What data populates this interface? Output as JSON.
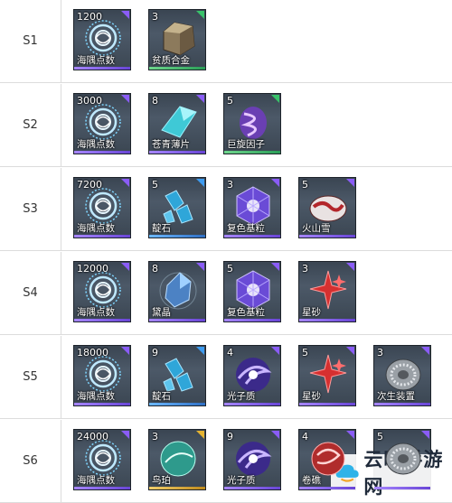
{
  "rows": [
    {
      "tier": "S1",
      "items": [
        {
          "count": "1200",
          "name": "海隅点数",
          "icon": "token-icon",
          "rarity": "purple"
        },
        {
          "count": "3",
          "name": "贫质合金",
          "icon": "alloy-icon",
          "rarity": "green"
        }
      ]
    },
    {
      "tier": "S2",
      "items": [
        {
          "count": "3000",
          "name": "海隅点数",
          "icon": "token-icon",
          "rarity": "purple"
        },
        {
          "count": "8",
          "name": "苍青薄片",
          "icon": "cyan-shard-icon",
          "rarity": "purple"
        },
        {
          "count": "5",
          "name": "巨旋因子",
          "icon": "spiral-factor-icon",
          "rarity": "green"
        }
      ]
    },
    {
      "tier": "S3",
      "items": [
        {
          "count": "7200",
          "name": "海隅点数",
          "icon": "token-icon",
          "rarity": "purple"
        },
        {
          "count": "5",
          "name": "靛石",
          "icon": "indigo-stone-icon",
          "rarity": "blue"
        },
        {
          "count": "3",
          "name": "复色基粒",
          "icon": "multicolor-granule-icon",
          "rarity": "purple"
        },
        {
          "count": "5",
          "name": "火山雪",
          "icon": "volcanic-snow-icon",
          "rarity": "purple"
        }
      ]
    },
    {
      "tier": "S4",
      "items": [
        {
          "count": "12000",
          "name": "海隅点数",
          "icon": "token-icon",
          "rarity": "purple"
        },
        {
          "count": "8",
          "name": "黛晶",
          "icon": "dark-crystal-icon",
          "rarity": "purple"
        },
        {
          "count": "5",
          "name": "复色基粒",
          "icon": "multicolor-granule-icon",
          "rarity": "purple"
        },
        {
          "count": "3",
          "name": "星砂",
          "icon": "star-sand-icon",
          "rarity": "purple"
        }
      ]
    },
    {
      "tier": "S5",
      "items": [
        {
          "count": "18000",
          "name": "海隅点数",
          "icon": "token-icon",
          "rarity": "purple"
        },
        {
          "count": "9",
          "name": "靛石",
          "icon": "indigo-stone-icon",
          "rarity": "blue"
        },
        {
          "count": "4",
          "name": "光子质",
          "icon": "photon-matter-icon",
          "rarity": "purple"
        },
        {
          "count": "5",
          "name": "星砂",
          "icon": "star-sand-icon",
          "rarity": "purple"
        },
        {
          "count": "3",
          "name": "次生装置",
          "icon": "secondary-device-icon",
          "rarity": "purple"
        }
      ]
    },
    {
      "tier": "S6",
      "items": [
        {
          "count": "24000",
          "name": "海隅点数",
          "icon": "token-icon",
          "rarity": "purple"
        },
        {
          "count": "3",
          "name": "鸟珀",
          "icon": "bird-amber-icon",
          "rarity": "gold"
        },
        {
          "count": "9",
          "name": "光子质",
          "icon": "photon-matter-icon",
          "rarity": "purple"
        },
        {
          "count": "4",
          "name": "卷礁",
          "icon": "coiled-reef-icon",
          "rarity": "purple"
        },
        {
          "count": "5",
          "name": "",
          "icon": "secondary-device-icon",
          "rarity": "purple"
        }
      ]
    }
  ],
  "watermark": {
    "text": "云曦手游网",
    "icon": "cloud-logo-icon"
  }
}
